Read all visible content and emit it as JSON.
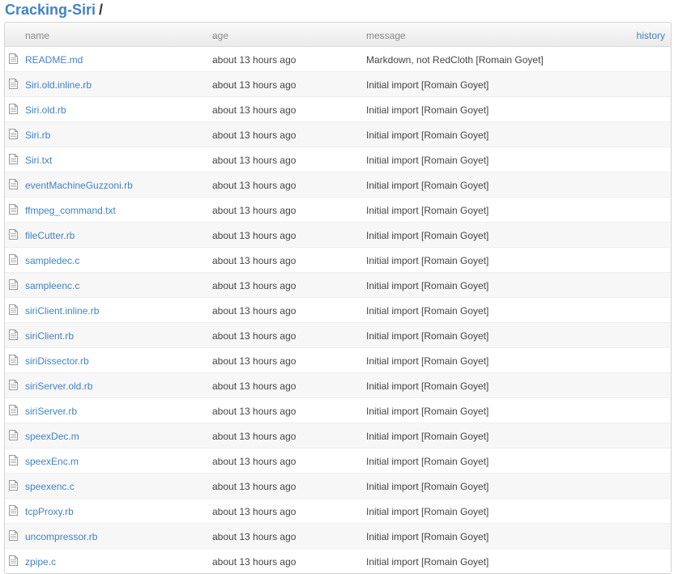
{
  "breadcrumb": {
    "repo": "Cracking-Siri",
    "separator": "/"
  },
  "header": {
    "name": "name",
    "age": "age",
    "message": "message",
    "history": "history"
  },
  "files": [
    {
      "name": "README.md",
      "age": "about 13 hours ago",
      "message": "Markdown, not RedCloth [Romain Goyet]"
    },
    {
      "name": "Siri.old.inline.rb",
      "age": "about 13 hours ago",
      "message": "Initial import [Romain Goyet]"
    },
    {
      "name": "Siri.old.rb",
      "age": "about 13 hours ago",
      "message": "Initial import [Romain Goyet]"
    },
    {
      "name": "Siri.rb",
      "age": "about 13 hours ago",
      "message": "Initial import [Romain Goyet]"
    },
    {
      "name": "Siri.txt",
      "age": "about 13 hours ago",
      "message": "Initial import [Romain Goyet]"
    },
    {
      "name": "eventMachineGuzzoni.rb",
      "age": "about 13 hours ago",
      "message": "Initial import [Romain Goyet]"
    },
    {
      "name": "ffmpeg_command.txt",
      "age": "about 13 hours ago",
      "message": "Initial import [Romain Goyet]"
    },
    {
      "name": "fileCutter.rb",
      "age": "about 13 hours ago",
      "message": "Initial import [Romain Goyet]"
    },
    {
      "name": "sampledec.c",
      "age": "about 13 hours ago",
      "message": "Initial import [Romain Goyet]"
    },
    {
      "name": "sampleenc.c",
      "age": "about 13 hours ago",
      "message": "Initial import [Romain Goyet]"
    },
    {
      "name": "siriClient.inline.rb",
      "age": "about 13 hours ago",
      "message": "Initial import [Romain Goyet]"
    },
    {
      "name": "siriClient.rb",
      "age": "about 13 hours ago",
      "message": "Initial import [Romain Goyet]"
    },
    {
      "name": "siriDissector.rb",
      "age": "about 13 hours ago",
      "message": "Initial import [Romain Goyet]"
    },
    {
      "name": "siriServer.old.rb",
      "age": "about 13 hours ago",
      "message": "Initial import [Romain Goyet]"
    },
    {
      "name": "siriServer.rb",
      "age": "about 13 hours ago",
      "message": "Initial import [Romain Goyet]"
    },
    {
      "name": "speexDec.m",
      "age": "about 13 hours ago",
      "message": "Initial import [Romain Goyet]"
    },
    {
      "name": "speexEnc.m",
      "age": "about 13 hours ago",
      "message": "Initial import [Romain Goyet]"
    },
    {
      "name": "speexenc.c",
      "age": "about 13 hours ago",
      "message": "Initial import [Romain Goyet]"
    },
    {
      "name": "tcpProxy.rb",
      "age": "about 13 hours ago",
      "message": "Initial import [Romain Goyet]"
    },
    {
      "name": "uncompressor.rb",
      "age": "about 13 hours ago",
      "message": "Initial import [Romain Goyet]"
    },
    {
      "name": "zpipe.c",
      "age": "about 13 hours ago",
      "message": "Initial import [Romain Goyet]"
    }
  ],
  "file_icon": "file-text-icon",
  "colors": {
    "link": "#4183c4",
    "text": "#444444",
    "header_text": "#888888"
  }
}
